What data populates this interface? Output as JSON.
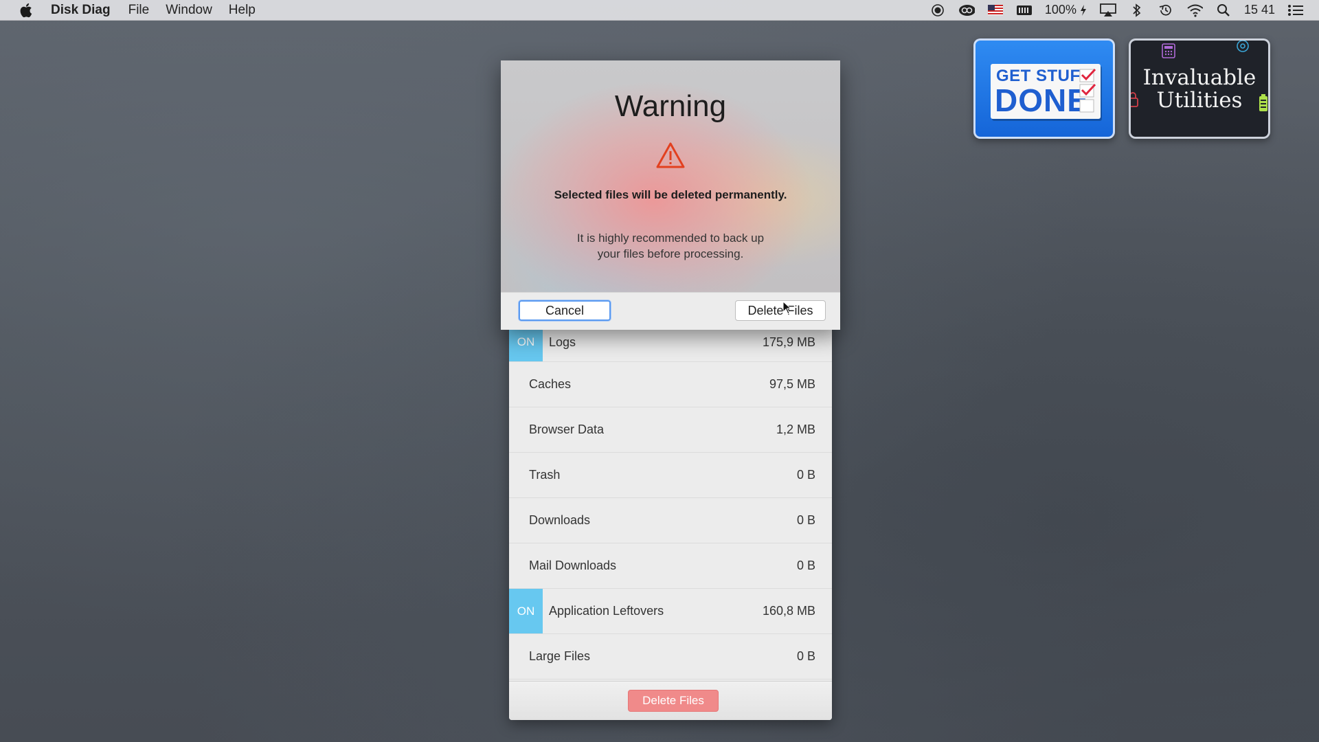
{
  "menubar": {
    "app_name": "Disk Diag",
    "menus": [
      "File",
      "Window",
      "Help"
    ],
    "battery": "100%",
    "clock": "15 41",
    "status_icons": [
      "record-icon",
      "creative-cloud-icon",
      "us-flag-icon",
      "memory-icon",
      "battery-charging-icon",
      "airplay-icon",
      "bluetooth-icon",
      "time-machine-icon",
      "wifi-icon",
      "spotlight-icon",
      "notification-center-icon"
    ]
  },
  "widgets": {
    "get_stuff_done": {
      "line1": "GET STUFF",
      "line2": "DONE"
    },
    "invaluable_utilities": {
      "line1": "Invaluable",
      "line2": "Utilities"
    }
  },
  "dialog": {
    "title": "Warning",
    "message": "Selected files will be deleted permanently.",
    "sub_line1": "It is highly recommended to back up",
    "sub_line2": "your files before processing.",
    "cancel_label": "Cancel",
    "delete_label": "Delete Files"
  },
  "list": {
    "on_label": "ON",
    "rows": [
      {
        "name": "Logs",
        "size": "175,9 MB",
        "on": true
      },
      {
        "name": "Caches",
        "size": "97,5 MB",
        "on": false
      },
      {
        "name": "Browser Data",
        "size": "1,2 MB",
        "on": false
      },
      {
        "name": "Trash",
        "size": "0 B",
        "on": false
      },
      {
        "name": "Downloads",
        "size": "0 B",
        "on": false
      },
      {
        "name": "Mail Downloads",
        "size": "0 B",
        "on": false
      },
      {
        "name": "Application Leftovers",
        "size": "160,8 MB",
        "on": true
      },
      {
        "name": "Large Files",
        "size": "0 B",
        "on": false
      }
    ],
    "footer_delete_label": "Delete Files"
  },
  "colors": {
    "on_badge": "#67c8f0",
    "footer_delete": "#f08a8a",
    "warning_icon": "#e2401f"
  }
}
